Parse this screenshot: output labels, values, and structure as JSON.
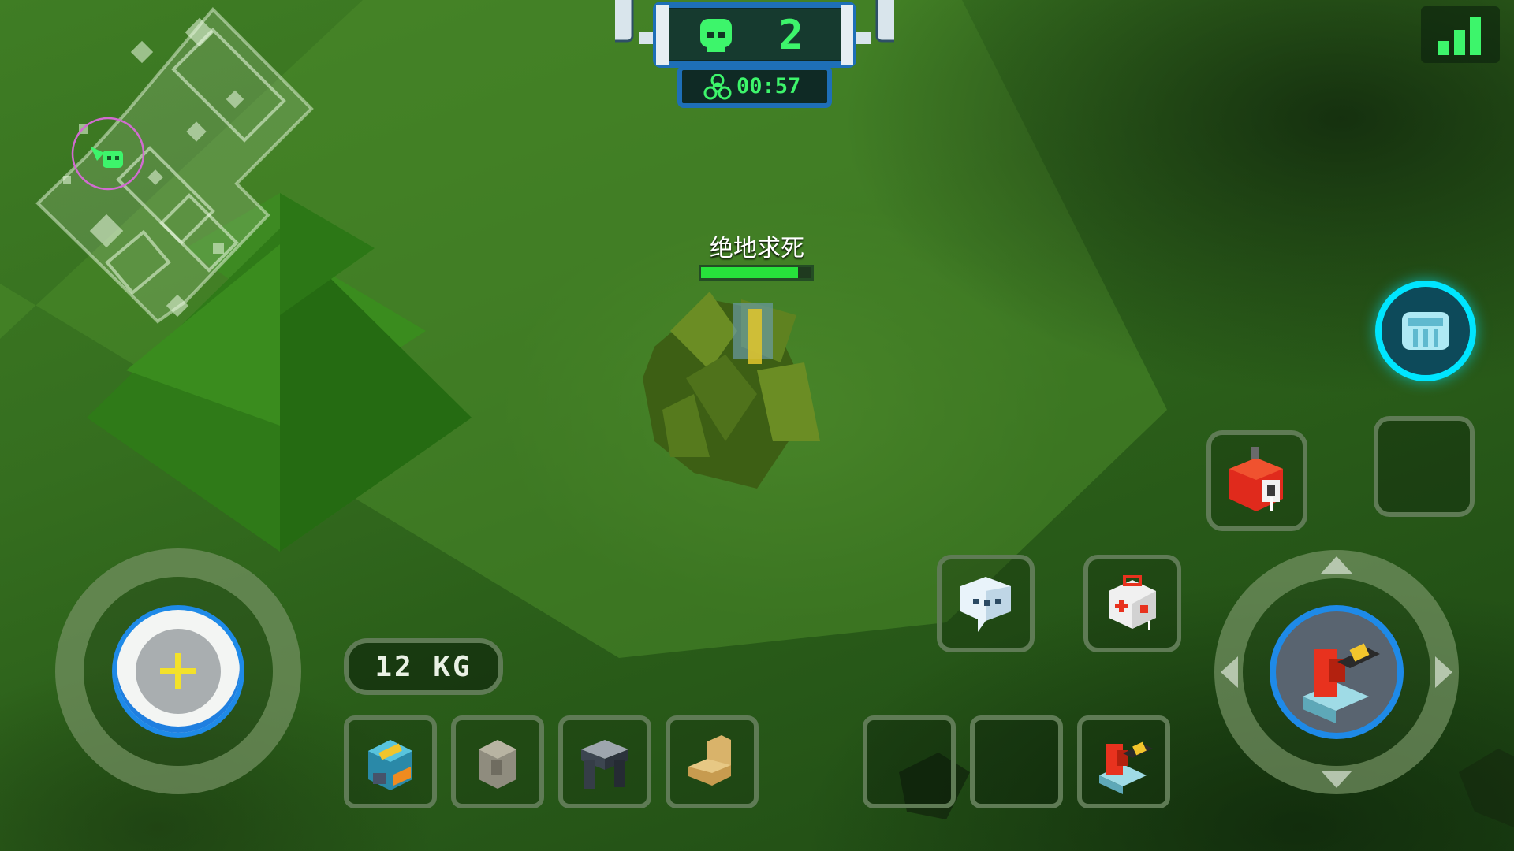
{
  "hud": {
    "alive_count": "2",
    "timer": "00:57",
    "player_name": "绝地求死",
    "player_health": 0.88,
    "weight": "12 KG"
  },
  "icons": {
    "alive": "skull-icon",
    "timer": "biohazard-icon",
    "signal": "signal-strength-icon",
    "armor": "armor-skill-icon",
    "grenade": "time-bomb-icon",
    "chat": "chat-bubble-icon",
    "medkit": "medkit-icon",
    "fire": "fire-weapon-icon",
    "move": "movement-joystick-icon"
  },
  "inventory": {
    "equipment": [
      "backpack-item",
      "vest-item",
      "pants-item",
      "boots-item"
    ],
    "weapons": [
      "empty-weapon-slot",
      "empty-weapon-slot",
      "flamethrower-item"
    ]
  },
  "colors": {
    "accent": "#00e5ff",
    "hud_green": "#3df56b",
    "health": "#27e33b",
    "slot_border": "#5f7b55"
  }
}
